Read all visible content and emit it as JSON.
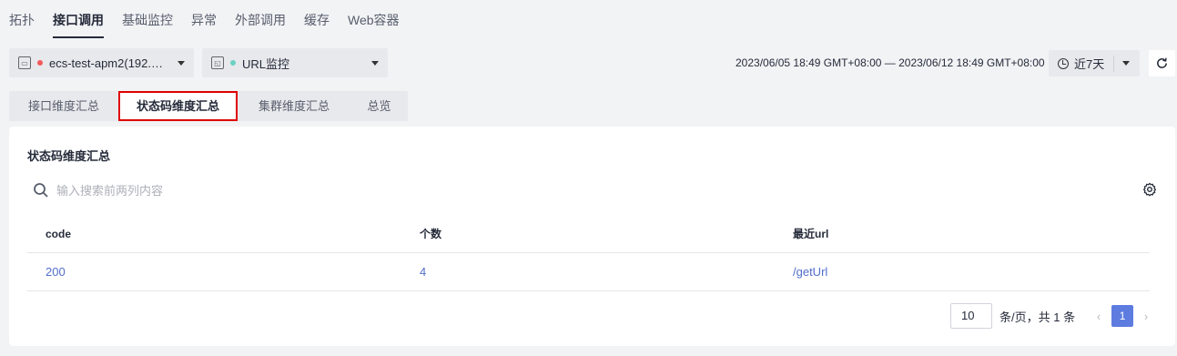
{
  "top_tabs": [
    {
      "label": "拓扑"
    },
    {
      "label": "接口调用",
      "active": true
    },
    {
      "label": "基础监控"
    },
    {
      "label": "异常"
    },
    {
      "label": "外部调用"
    },
    {
      "label": "缓存"
    },
    {
      "label": "Web容器"
    }
  ],
  "filters": {
    "instance": {
      "label": "ecs-test-apm2(192.…",
      "status_color": "#f55a5a",
      "icon": "server-icon"
    },
    "monitor": {
      "label": "URL监控",
      "status_color": "#6bd1c1",
      "icon": "monitor-icon"
    }
  },
  "time_range": {
    "text": "2023/06/05 18:49 GMT+08:00 — 2023/06/12 18:49 GMT+08:00",
    "period_label": "近7天"
  },
  "sub_tabs": [
    {
      "label": "接口维度汇总"
    },
    {
      "label": "状态码维度汇总",
      "active": true
    },
    {
      "label": "集群维度汇总"
    },
    {
      "label": "总览"
    }
  ],
  "card": {
    "title": "状态码维度汇总",
    "search_placeholder": "输入搜索前两列内容"
  },
  "table": {
    "headers": [
      "code",
      "个数",
      "最近url"
    ],
    "rows": [
      [
        "200",
        "4",
        "/getUrl"
      ]
    ]
  },
  "pagination": {
    "page_size": "10",
    "info": "条/页，共 1 条",
    "current_page": "1"
  },
  "colors": {
    "accent": "#5e7ce0",
    "link": "#526ecc",
    "highlight_border": "#e00000"
  }
}
